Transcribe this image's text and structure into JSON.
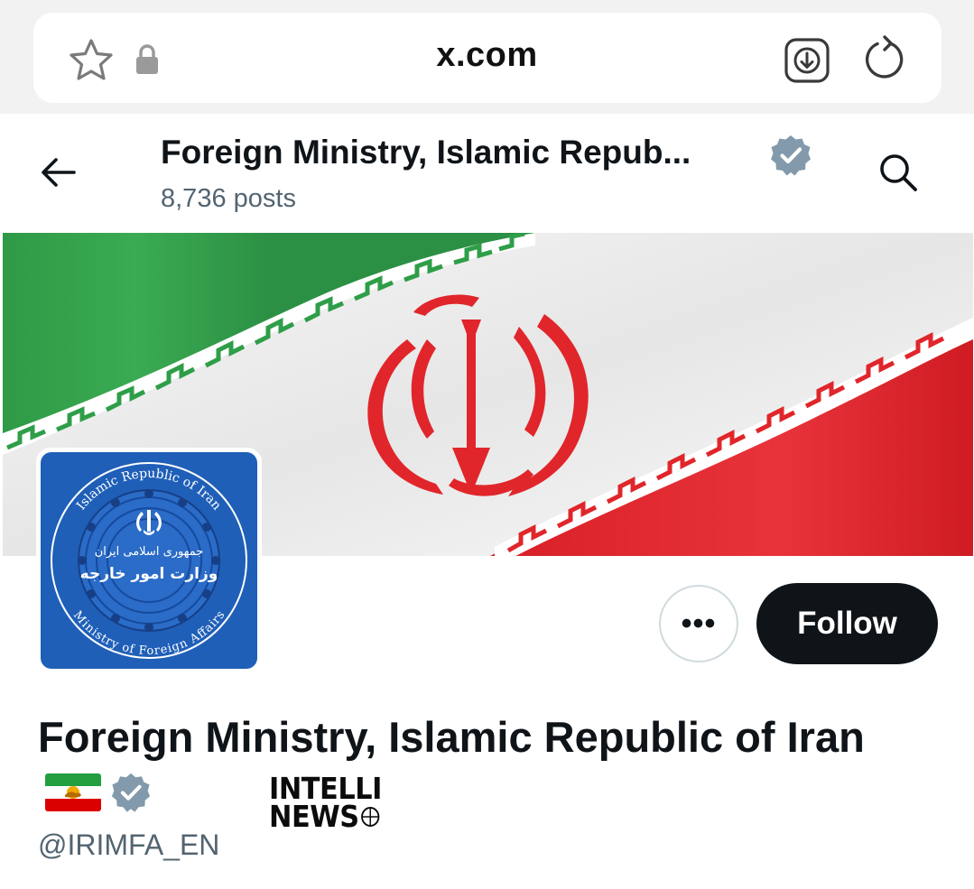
{
  "browser": {
    "url": "x.com",
    "icons": [
      "star-icon",
      "lock-icon",
      "download-icon",
      "reload-icon"
    ]
  },
  "header": {
    "title": "Foreign Ministry, Islamic Repub...",
    "post_count": "8,736 posts",
    "icons": [
      "back-arrow-icon",
      "verified-badge-icon",
      "search-icon"
    ]
  },
  "banner": {
    "colors": {
      "green": "#2e9e48",
      "white": "#f4f4f4",
      "red": "#e0262b"
    }
  },
  "avatar": {
    "arc_top_text": "Islamic Republic of Iran",
    "arc_bottom_text": "Ministry of Foreign Affairs",
    "persian_line1": "جمهوری اسلامی ایران",
    "persian_line2": "وزارت امور خارجه",
    "colors": {
      "background": "#1f5fb8",
      "ring": "#ffffff"
    }
  },
  "actions": {
    "more_label": "•••",
    "follow_label": "Follow"
  },
  "profile": {
    "display_name": "Foreign Ministry, Islamic Republic of Iran",
    "handle": "@IRIMFA_EN",
    "flag_icon": "iran-lion-sun-flag-icon",
    "badge_icon": "verified-badge-icon"
  },
  "watermark": {
    "line1": "INTELLI",
    "line2": "NEWS"
  },
  "colors": {
    "text_primary": "#0f1419",
    "text_secondary": "#536471",
    "badge_gray": "#829aab"
  }
}
